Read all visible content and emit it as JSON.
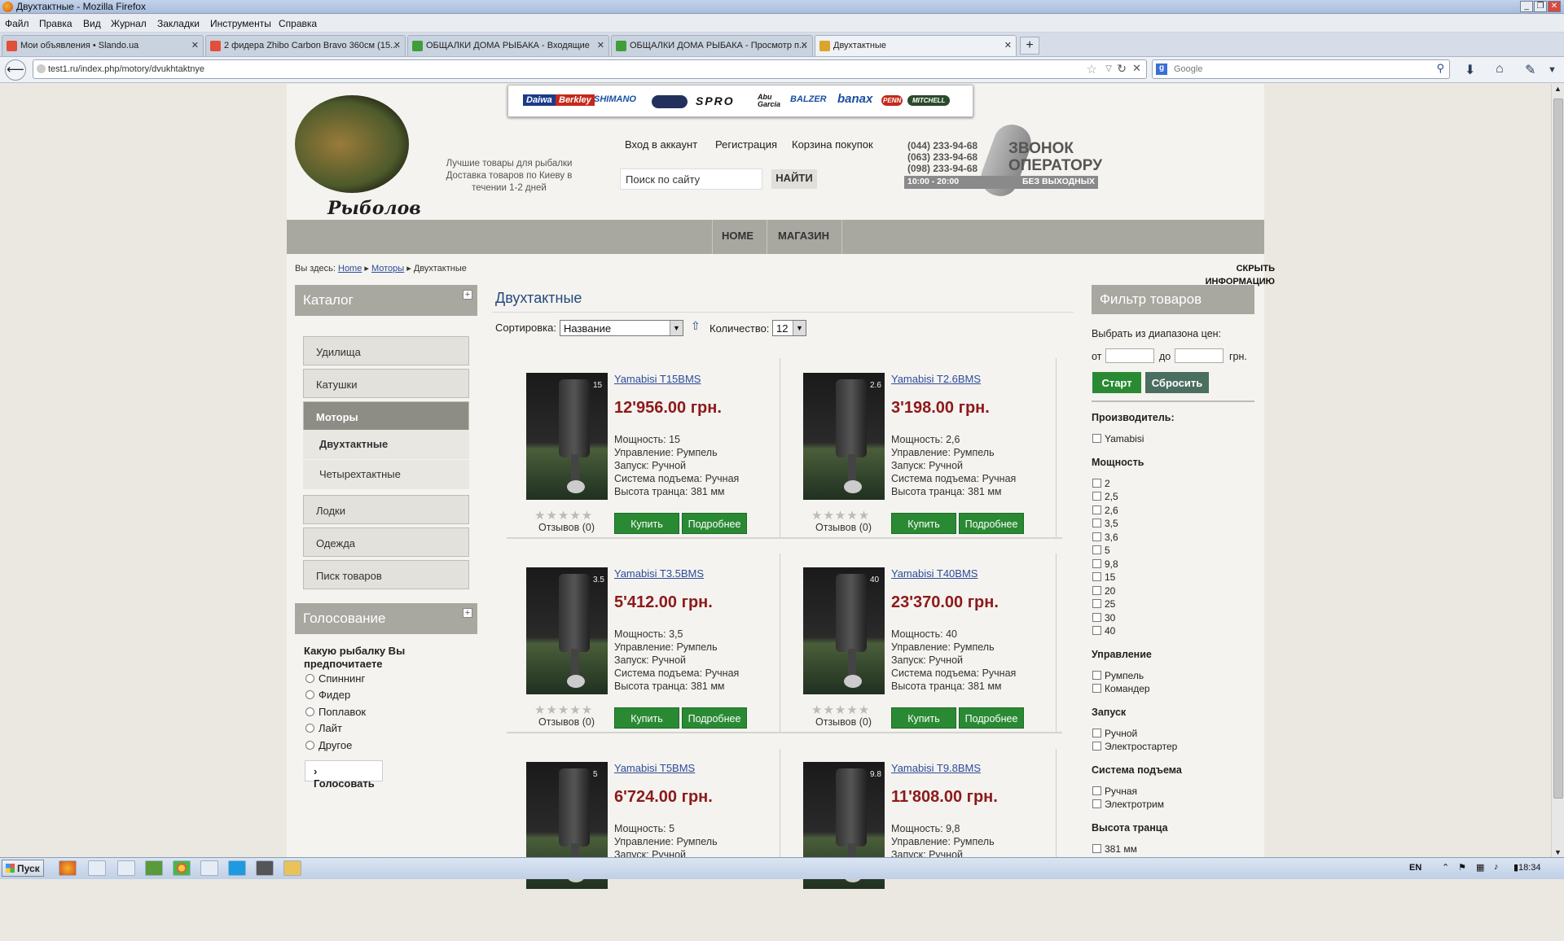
{
  "window": {
    "title": "Двухтактные - Mozilla Firefox"
  },
  "menu": [
    "Файл",
    "Правка",
    "Вид",
    "Журнал",
    "Закладки",
    "Инструменты",
    "Справка"
  ],
  "tabs": [
    {
      "label": "Мои объявления • Slando.ua",
      "color": "#e24f3a"
    },
    {
      "label": "2 фидера Zhibo Carbon Bravo 360см (15...",
      "color": "#e24f3a"
    },
    {
      "label": "ОБЩАЛКИ ДОМА РЫБАКА - Входящие",
      "color": "#3f9e3a"
    },
    {
      "label": "ОБЩАЛКИ ДОМА РЫБАКА - Просмотр п...",
      "color": "#3f9e3a"
    },
    {
      "label": "Двухтактные",
      "color": "#d9a52b"
    }
  ],
  "url": "test1.ru/index.php/motory/dvukhtaktnye",
  "search_placeholder": "Google",
  "header": {
    "logo_text": "Рыболов",
    "tagline": "Лучшие товары для рыбалки Доставка товаров по Киеву в течении 1-2 дней",
    "brands": [
      "Daiwa",
      "Berkley",
      "SHIMANO",
      "SPRO",
      "Abu Garcia",
      "BALZER",
      "banax",
      "PENN",
      "MITCHELL"
    ],
    "links": [
      "Вход в аккаунт",
      "Регистрация",
      "Корзина покупок"
    ],
    "search_value": "Поиск по сайту",
    "search_button": "НАЙТИ",
    "phones": [
      "(044) 233-94-68",
      "(063) 233-94-68",
      "(098) 233-94-68"
    ],
    "hours": "10:00 - 20:00",
    "no_days_off": "БЕЗ ВЫХОДНЫХ",
    "call_line1": "ЗВОНОК",
    "call_line2": "ОПЕРАТОРУ"
  },
  "nav": [
    "HOME",
    "МАГАЗИН"
  ],
  "breadcrumb": {
    "prefix": "Вы здесь:",
    "home": "Home",
    "section": "Моторы",
    "current": "Двухтактные"
  },
  "hide_info": "СКРЫТЬ ИНФОРМАЦИЮ",
  "catalog": {
    "title": "Каталог",
    "items": [
      "Удилища",
      "Катушки",
      "Моторы"
    ],
    "sub": [
      "Двухтактные",
      "Четырехтактные"
    ],
    "items_after": [
      "Лодки",
      "Одежда",
      "Писк товаров"
    ]
  },
  "poll": {
    "title": "Голосование",
    "question": "Какую рыбалку Вы предпочитаете",
    "options": [
      "Спиннинг",
      "Фидер",
      "Поплавок",
      "Лайт",
      "Другое"
    ],
    "button": "Голосовать"
  },
  "category": {
    "title": "Двухтактные",
    "sort_label": "Сортировка:",
    "sort_value": "Название",
    "qty_label": "Количество:",
    "qty_value": "12"
  },
  "product_labels": {
    "power": "Мощность:",
    "control": "Управление:",
    "start": "Запуск:",
    "lift": "Система подъема:",
    "transom": "Высота транца:",
    "buy": "Купить",
    "more": "Подробнее",
    "reviews": "Отзывов (0)"
  },
  "products": [
    {
      "name": "Yamabisi T15BMS",
      "price": "12'956.00 грн.",
      "power": "15",
      "control": "Румпель",
      "start": "Ручной",
      "lift": "Ручная",
      "transom": "381 мм",
      "badge": "15"
    },
    {
      "name": "Yamabisi T2.6BMS",
      "price": "3'198.00 грн.",
      "power": "2,6",
      "control": "Румпель",
      "start": "Ручной",
      "lift": "Ручная",
      "transom": "381 мм",
      "badge": "2.6"
    },
    {
      "name": "Yamabisi T3.5BMS",
      "price": "5'412.00 грн.",
      "power": "3,5",
      "control": "Румпель",
      "start": "Ручной",
      "lift": "Ручная",
      "transom": "381 мм",
      "badge": "3.5"
    },
    {
      "name": "Yamabisi T40BMS",
      "price": "23'370.00 грн.",
      "power": "40",
      "control": "Румпель",
      "start": "Ручной",
      "lift": "Ручная",
      "transom": "381 мм",
      "badge": "40"
    },
    {
      "name": "Yamabisi T5BMS",
      "price": "6'724.00 грн.",
      "power": "5",
      "control": "Румпель",
      "start": "Ручной",
      "lift": "",
      "transom": "",
      "badge": "5"
    },
    {
      "name": "Yamabisi T9.8BMS",
      "price": "11'808.00 грн.",
      "power": "9,8",
      "control": "Румпель",
      "start": "Ручной",
      "lift": "",
      "transom": "",
      "badge": "9.8"
    }
  ],
  "filter": {
    "title": "Фильтр товаров",
    "range_label": "Выбрать из диапазона цен:",
    "from": "от",
    "to": "до",
    "currency": "грн.",
    "start": "Старт",
    "reset": "Сбросить",
    "manufacturer_title": "Производитель:",
    "manufacturers": [
      "Yamabisi"
    ],
    "power_title": "Мощность",
    "powers": [
      "2",
      "2,5",
      "2,6",
      "3,5",
      "3,6",
      "5",
      "9,8",
      "15",
      "20",
      "25",
      "30",
      "40"
    ],
    "control_title": "Управление",
    "controls": [
      "Румпель",
      "Командер"
    ],
    "start_title": "Запуск",
    "starts": [
      "Ручной",
      "Электростартер"
    ],
    "lift_title": "Система подъема",
    "lifts": [
      "Ручная",
      "Электротрим"
    ],
    "transom_title": "Высота транца",
    "transoms": [
      "381 мм"
    ]
  },
  "taskbar": {
    "start": "Пуск",
    "lang": "EN",
    "time": "18:34"
  }
}
